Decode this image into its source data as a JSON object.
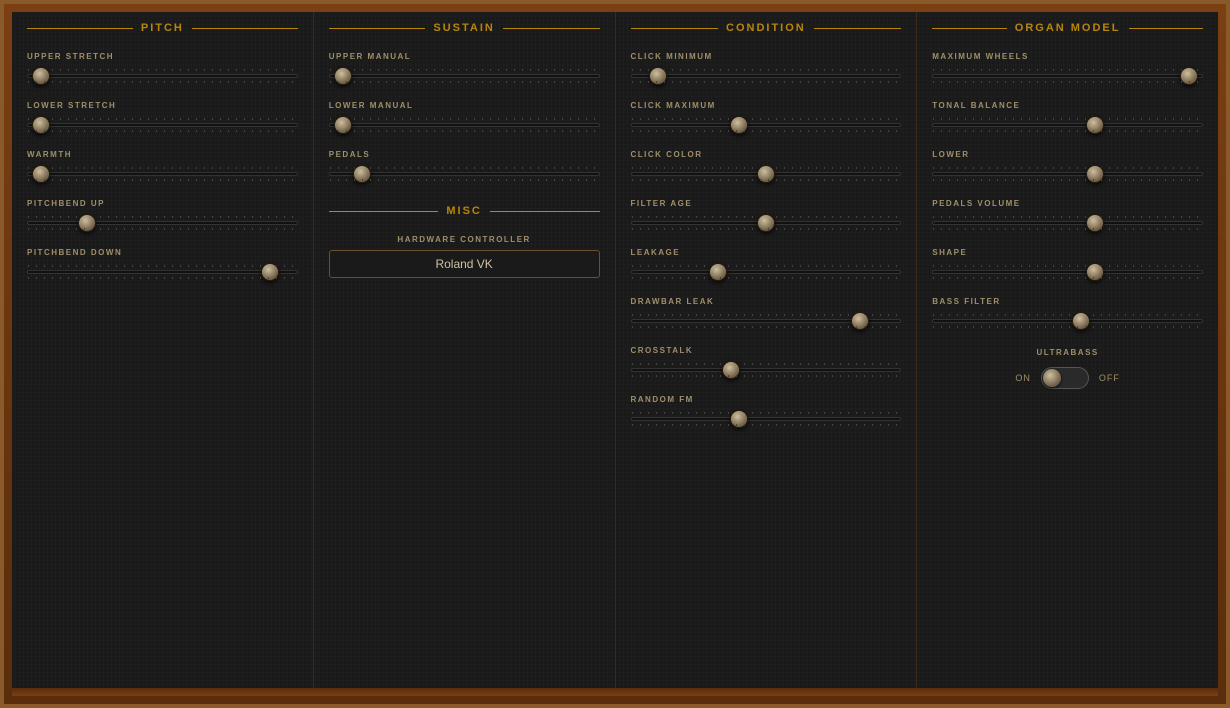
{
  "sections": {
    "pitch": {
      "title": "PITCH",
      "sliders": [
        {
          "label": "UPPER STRETCH",
          "value": 5
        },
        {
          "label": "LOWER STRETCH",
          "value": 5
        },
        {
          "label": "WARMTH",
          "value": 5
        },
        {
          "label": "PITCHBEND UP",
          "value": 22
        },
        {
          "label": "PITCHBEND DOWN",
          "value": 90
        }
      ]
    },
    "sustain": {
      "title": "SUSTAIN",
      "sliders": [
        {
          "label": "UPPER MANUAL",
          "value": 5
        },
        {
          "label": "LOWER MANUAL",
          "value": 5
        },
        {
          "label": "PEDALS",
          "value": 12
        }
      ],
      "misc": {
        "title": "MISC",
        "hw_label": "HARDWARE CONTROLLER",
        "hw_value": "Roland VK"
      }
    },
    "condition": {
      "title": "CONDITION",
      "sliders": [
        {
          "label": "CLICK MINIMUM",
          "value": 10
        },
        {
          "label": "CLICK MAXIMUM",
          "value": 40
        },
        {
          "label": "CLICK COLOR",
          "value": 50
        },
        {
          "label": "FILTER AGE",
          "value": 50
        },
        {
          "label": "LEAKAGE",
          "value": 32
        },
        {
          "label": "DRAWBAR LEAK",
          "value": 85
        },
        {
          "label": "CROSSTALK",
          "value": 37
        },
        {
          "label": "RANDOM FM",
          "value": 40
        }
      ]
    },
    "organ_model": {
      "title": "ORGAN MODEL",
      "sliders": [
        {
          "label": "MAXIMUM WHEELS",
          "value": 95
        },
        {
          "label": "TONAL BALANCE",
          "value": 60
        },
        {
          "label": "LOWER",
          "value": 60
        },
        {
          "label": "PEDALS VOLUME",
          "value": 60
        },
        {
          "label": "SHAPE",
          "value": 60
        },
        {
          "label": "BASS FILTER",
          "value": 55
        }
      ],
      "ultrabass": {
        "label": "ULTRABASS",
        "on_label": "ON",
        "off_label": "OFF",
        "state": "on"
      }
    }
  }
}
